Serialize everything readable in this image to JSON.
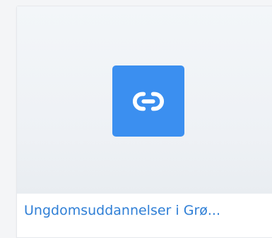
{
  "card": {
    "title": "Ungdomsuddannelser i Grø...",
    "icon": "link-icon",
    "accent_color": "#3b8ff0",
    "title_color": "#2f7fd6"
  }
}
